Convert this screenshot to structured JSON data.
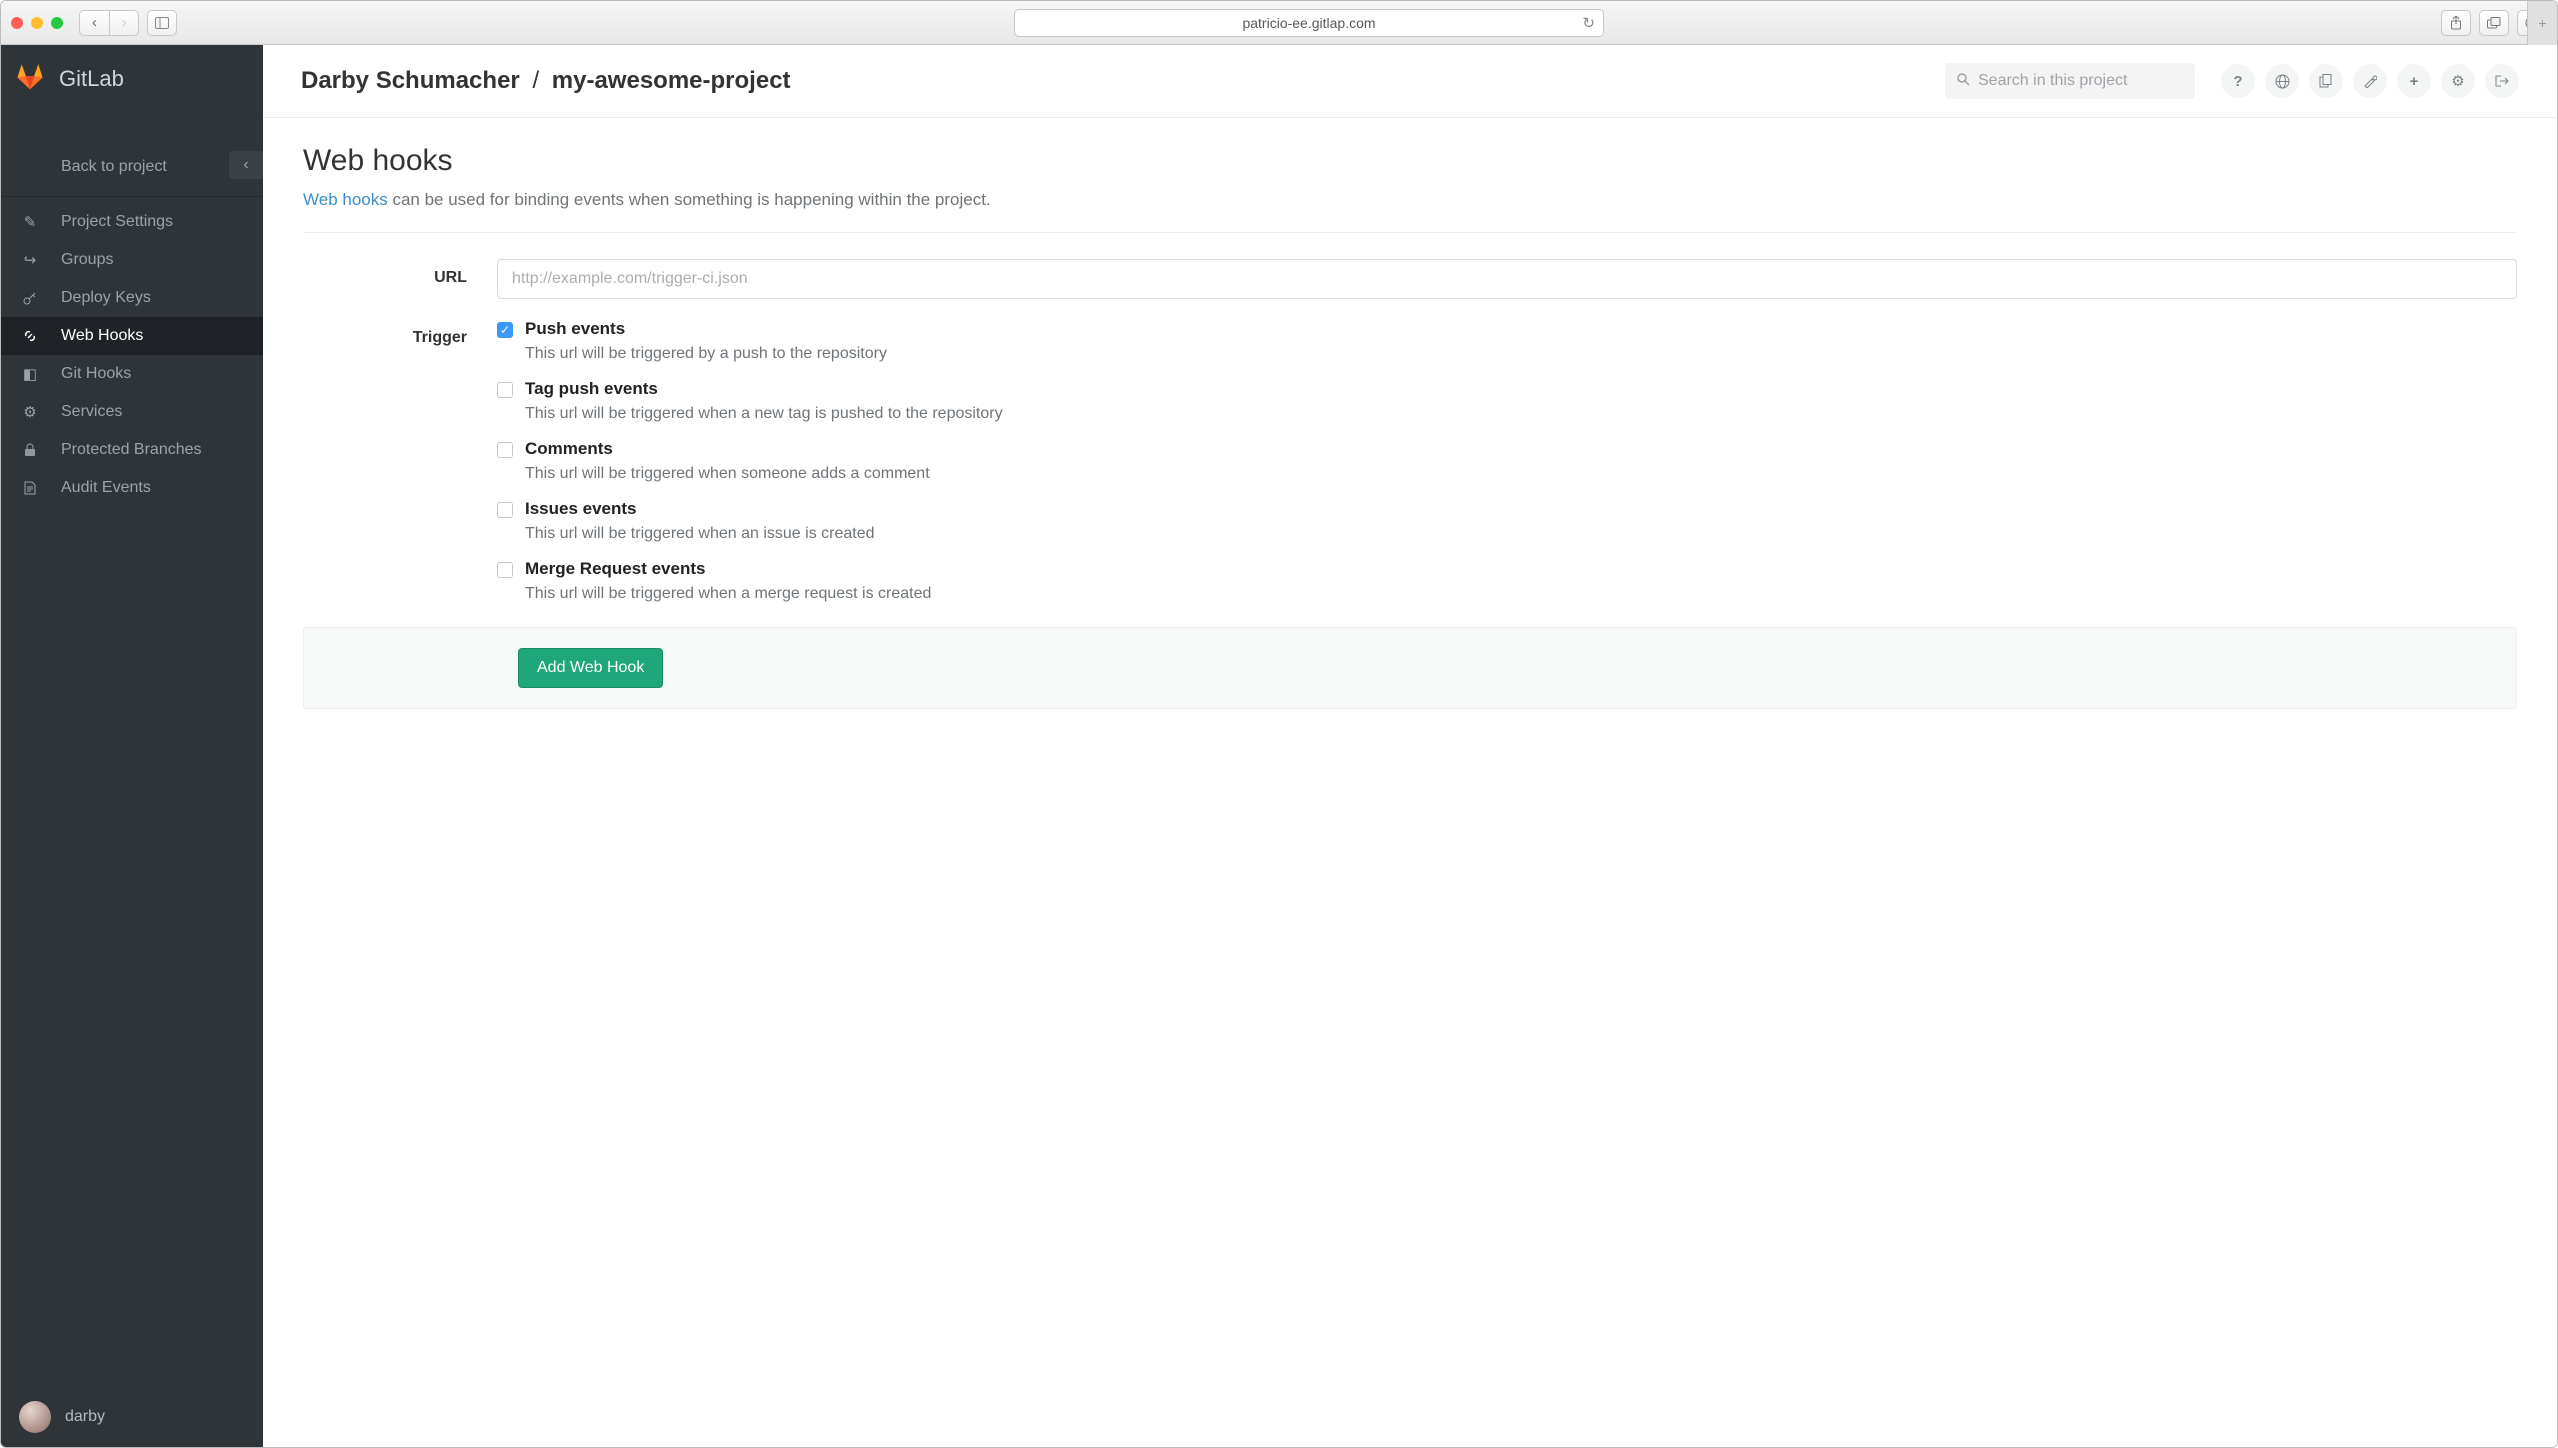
{
  "browser": {
    "url": "patricio-ee.gitlap.com"
  },
  "sidebar": {
    "brand": "GitLab",
    "back_label": "Back to project",
    "items": [
      {
        "label": "Project Settings",
        "icon": "edit-icon"
      },
      {
        "label": "Groups",
        "icon": "share-icon"
      },
      {
        "label": "Deploy Keys",
        "icon": "key-icon"
      },
      {
        "label": "Web Hooks",
        "icon": "link-icon"
      },
      {
        "label": "Git Hooks",
        "icon": "git-icon"
      },
      {
        "label": "Services",
        "icon": "gears-icon"
      },
      {
        "label": "Protected Branches",
        "icon": "lock-icon"
      },
      {
        "label": "Audit Events",
        "icon": "file-icon"
      }
    ],
    "user": "darby"
  },
  "header": {
    "breadcrumb_owner": "Darby Schumacher",
    "breadcrumb_project": "my-awesome-project",
    "search_placeholder": "Search in this project"
  },
  "page": {
    "title": "Web hooks",
    "desc_link": "Web hooks",
    "desc_rest": " can be used for binding events when something is happening within the project."
  },
  "form": {
    "url_label": "URL",
    "url_placeholder": "http://example.com/trigger-ci.json",
    "trigger_label": "Trigger",
    "triggers": [
      {
        "title": "Push events",
        "desc": "This url will be triggered by a push to the repository",
        "checked": true
      },
      {
        "title": "Tag push events",
        "desc": "This url will be triggered when a new tag is pushed to the repository",
        "checked": false
      },
      {
        "title": "Comments",
        "desc": "This url will be triggered when someone adds a comment",
        "checked": false
      },
      {
        "title": "Issues events",
        "desc": "This url will be triggered when an issue is created",
        "checked": false
      },
      {
        "title": "Merge Request events",
        "desc": "This url will be triggered when a merge request is created",
        "checked": false
      }
    ],
    "submit": "Add Web Hook"
  }
}
